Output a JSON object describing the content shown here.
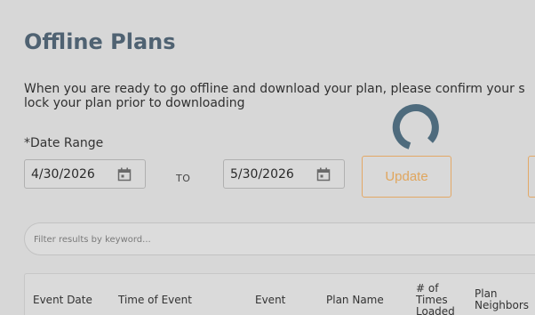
{
  "page": {
    "title": "Offline Plans",
    "description_line1": "When you are ready to go offline and download your plan, please confirm your s",
    "description_line2": "lock your plan prior to downloading"
  },
  "date_range": {
    "label": "*Date Range",
    "start_value": "4/30/2026",
    "to_label": "TO",
    "end_value": "5/30/2026",
    "calendar_icon": "calendar-icon"
  },
  "actions": {
    "update_label": "Update"
  },
  "filter": {
    "placeholder": "Filter results by keyword..."
  },
  "table": {
    "headers": [
      "Event Date",
      "Time of Event",
      "Event",
      "Plan Name",
      "# of Times Loaded",
      "Plan Neighbors"
    ],
    "header_lines": {
      "times_loaded": [
        "# of",
        "Times",
        "Loaded"
      ],
      "plan_neighbors": [
        "Plan",
        "Neighbors"
      ]
    }
  },
  "colors": {
    "title": "#4f6272",
    "accent": "#e0a65e",
    "spinner": "#4e6b7d",
    "background": "#d7d7d7"
  }
}
